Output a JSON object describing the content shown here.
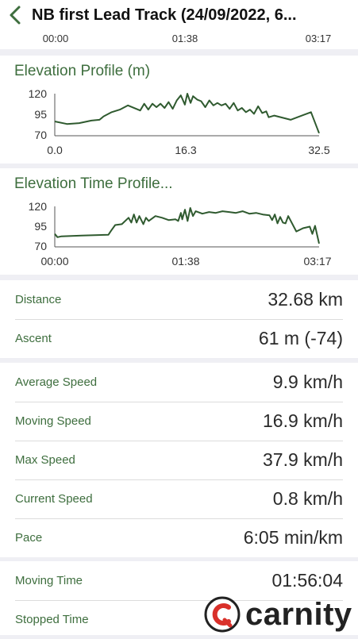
{
  "header": {
    "title": "NB first Lead Track (24/09/2022, 6..."
  },
  "speed_chart": {
    "x_ticks": [
      "00:00",
      "01:38",
      "03:17"
    ]
  },
  "elevation_profile": {
    "title": "Elevation Profile (m)",
    "y_ticks": [
      "120",
      "95",
      "70"
    ],
    "x_ticks": [
      "0.0",
      "16.3",
      "32.5"
    ]
  },
  "elevation_time_profile": {
    "title": "Elevation Time Profile...",
    "y_ticks": [
      "120",
      "95",
      "70"
    ],
    "x_ticks": [
      "00:00",
      "01:38",
      "03:17"
    ]
  },
  "stats": {
    "distance": {
      "label": "Distance",
      "value": "32.68 km"
    },
    "ascent": {
      "label": "Ascent",
      "value": "61 m (-74)"
    },
    "average_speed": {
      "label": "Average Speed",
      "value": "9.9 km/h"
    },
    "moving_speed": {
      "label": "Moving Speed",
      "value": "16.9 km/h"
    },
    "max_speed": {
      "label": "Max Speed",
      "value": "37.9 km/h"
    },
    "current_speed": {
      "label": "Current Speed",
      "value": "0.8 km/h"
    },
    "pace": {
      "label": "Pace",
      "value": "6:05 min/km"
    },
    "moving_time": {
      "label": "Moving Time",
      "value": "01:56:04"
    },
    "stopped_time": {
      "label": "Stopped Time",
      "value": ""
    }
  },
  "watermark": {
    "text": "carnity"
  },
  "colors": {
    "accent": "#3e6e3e",
    "line": "#2f5a2f",
    "background": "#efeff4"
  },
  "chart_data": [
    {
      "type": "line",
      "title": "Elevation Profile (m)",
      "xlabel": "",
      "ylabel": "",
      "xlim": [
        0,
        32.5
      ],
      "ylim": [
        70,
        120
      ],
      "x_ticks": [
        0.0,
        16.3,
        32.5
      ],
      "y_ticks": [
        70,
        95,
        120
      ],
      "series": [
        {
          "x": [
            0,
            1.5,
            3.0,
            4.5,
            5.5,
            6.0,
            7.0,
            8.0,
            9.0,
            10.5,
            11.0,
            11.5,
            12.0,
            12.5,
            13.0,
            13.5,
            14.0,
            14.5,
            15.0,
            15.5,
            16.0,
            16.3,
            16.7,
            17.0,
            17.5,
            18.0,
            18.5,
            19.0,
            19.5,
            20.0,
            20.5,
            21.0,
            21.5,
            22.0,
            22.5,
            23.0,
            23.5,
            24.0,
            24.5,
            25.0,
            25.5,
            26.0,
            26.3,
            27.0,
            29.0,
            31.5,
            32.5
          ],
          "y": [
            87,
            84,
            85,
            88,
            89,
            93,
            98,
            101,
            106,
            100,
            108,
            101,
            108,
            104,
            108,
            103,
            110,
            102,
            112,
            118,
            107,
            120,
            109,
            117,
            113,
            111,
            104,
            112,
            106,
            109,
            106,
            108,
            102,
            109,
            100,
            103,
            98,
            101,
            96,
            105,
            97,
            99,
            92,
            94,
            89,
            98,
            73
          ]
        }
      ]
    },
    {
      "type": "line",
      "title": "Elevation Time Profile...",
      "xlabel": "",
      "ylabel": "",
      "xlim": [
        0,
        197
      ],
      "ylim": [
        70,
        120
      ],
      "x_ticks": [
        "00:00",
        "01:38",
        "03:17"
      ],
      "y_ticks": [
        70,
        95,
        120
      ],
      "series": [
        {
          "x": [
            0,
            2,
            5,
            20,
            40,
            42,
            45,
            50,
            55,
            57,
            59,
            61,
            63,
            66,
            68,
            70,
            75,
            80,
            85,
            90,
            92,
            94,
            95,
            97,
            99,
            101,
            103,
            105,
            110,
            115,
            120,
            125,
            130,
            135,
            140,
            145,
            150,
            155,
            160,
            162,
            164,
            166,
            168,
            170,
            172,
            174,
            180,
            185,
            190,
            192,
            194,
            197
          ],
          "y": [
            86,
            82,
            83,
            84,
            85,
            90,
            97,
            98,
            106,
            100,
            110,
            100,
            108,
            98,
            106,
            102,
            108,
            106,
            103,
            104,
            102,
            112,
            104,
            116,
            102,
            118,
            108,
            114,
            111,
            113,
            112,
            114,
            113,
            112,
            114,
            111,
            112,
            110,
            109,
            103,
            110,
            99,
            107,
            100,
            99,
            108,
            89,
            93,
            95,
            86,
            96,
            74
          ]
        }
      ]
    }
  ]
}
